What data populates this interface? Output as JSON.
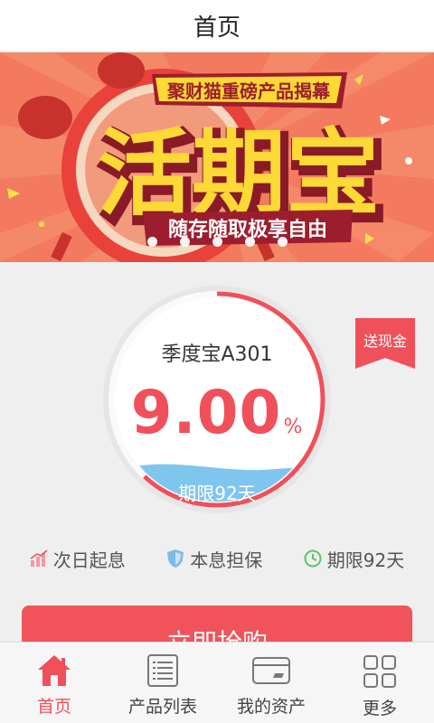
{
  "header": {
    "title": "首页"
  },
  "banner": {
    "tagline": "聚财猫重磅产品揭幕",
    "headline": "活期宝",
    "slogan": "随存随取极享自由",
    "dot_count": 5
  },
  "product": {
    "name": "季度宝A301",
    "rate": "9.00",
    "rate_unit": "%",
    "term_label": "期限92天",
    "ribbon": "送现金",
    "progress": 0.62
  },
  "features": [
    {
      "icon": "growth-chart-icon",
      "label": "次日起息"
    },
    {
      "icon": "shield-icon",
      "label": "本息担保"
    },
    {
      "icon": "clock-icon",
      "label": "期限92天"
    }
  ],
  "buy_button": {
    "label": "立即抢购"
  },
  "tabbar": {
    "tabs": [
      {
        "icon": "home-icon",
        "label": "首页",
        "active": true
      },
      {
        "icon": "list-icon",
        "label": "产品列表",
        "active": false
      },
      {
        "icon": "wallet-card-icon",
        "label": "我的资产",
        "active": false
      },
      {
        "icon": "grid-icon",
        "label": "更多",
        "active": false
      }
    ]
  },
  "colors": {
    "accent": "#f0505a",
    "banner_bg": "#f37a5f",
    "headline_yellow": "#fcd935",
    "wave_blue": "#7fc6ee"
  }
}
